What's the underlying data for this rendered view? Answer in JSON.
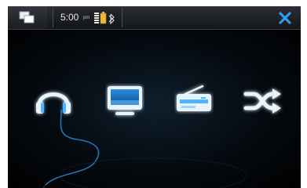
{
  "statusbar": {
    "time": "5:00",
    "ampm": "pm",
    "icons": [
      "signal-icon",
      "battery-icon",
      "bluetooth-icon"
    ],
    "close_icon": "close-icon",
    "switcher_icon": "task-switcher-icon"
  },
  "home": {
    "apps": [
      {
        "icon": "headphones-icon"
      },
      {
        "icon": "monitor-icon"
      },
      {
        "icon": "radio-icon"
      },
      {
        "icon": "shuffle-icon"
      }
    ]
  },
  "colors": {
    "accent": "#3aa0e6",
    "glow": "#1d73b8",
    "background": "#000000"
  }
}
